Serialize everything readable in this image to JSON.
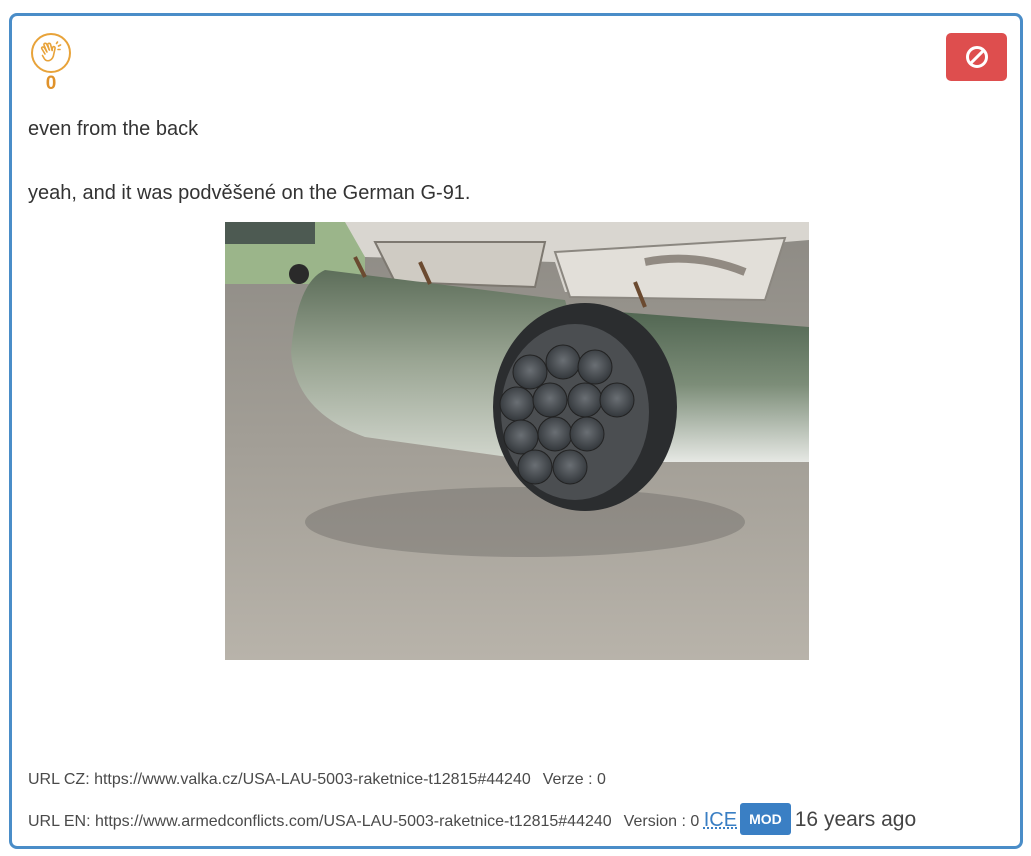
{
  "post": {
    "like_count": "0",
    "like_icon": "clap-icon",
    "block_icon": "ban-icon",
    "text_line1": "even from the back",
    "text_line2": "yeah, and it was podvěšené on the German G-91.",
    "photo_description": "photo"
  },
  "meta": {
    "url_cz": "URL CZ: https://www.valka.cz/USA-LAU-5003-raketnice-t12815#44240",
    "verze_cz": "Verze : 0",
    "url_en": "URL EN: https://www.armedconflicts.com/USA-LAU-5003-raketnice-t12815#44240",
    "version_en": "Version : 0",
    "author": "ICE",
    "role_badge": "MOD",
    "time_ago": "16 years ago"
  },
  "colors": {
    "border": "#4a8dc8",
    "like_accent": "#e8a33a",
    "block_button": "#de4e4e",
    "link": "#3a7fc4"
  }
}
